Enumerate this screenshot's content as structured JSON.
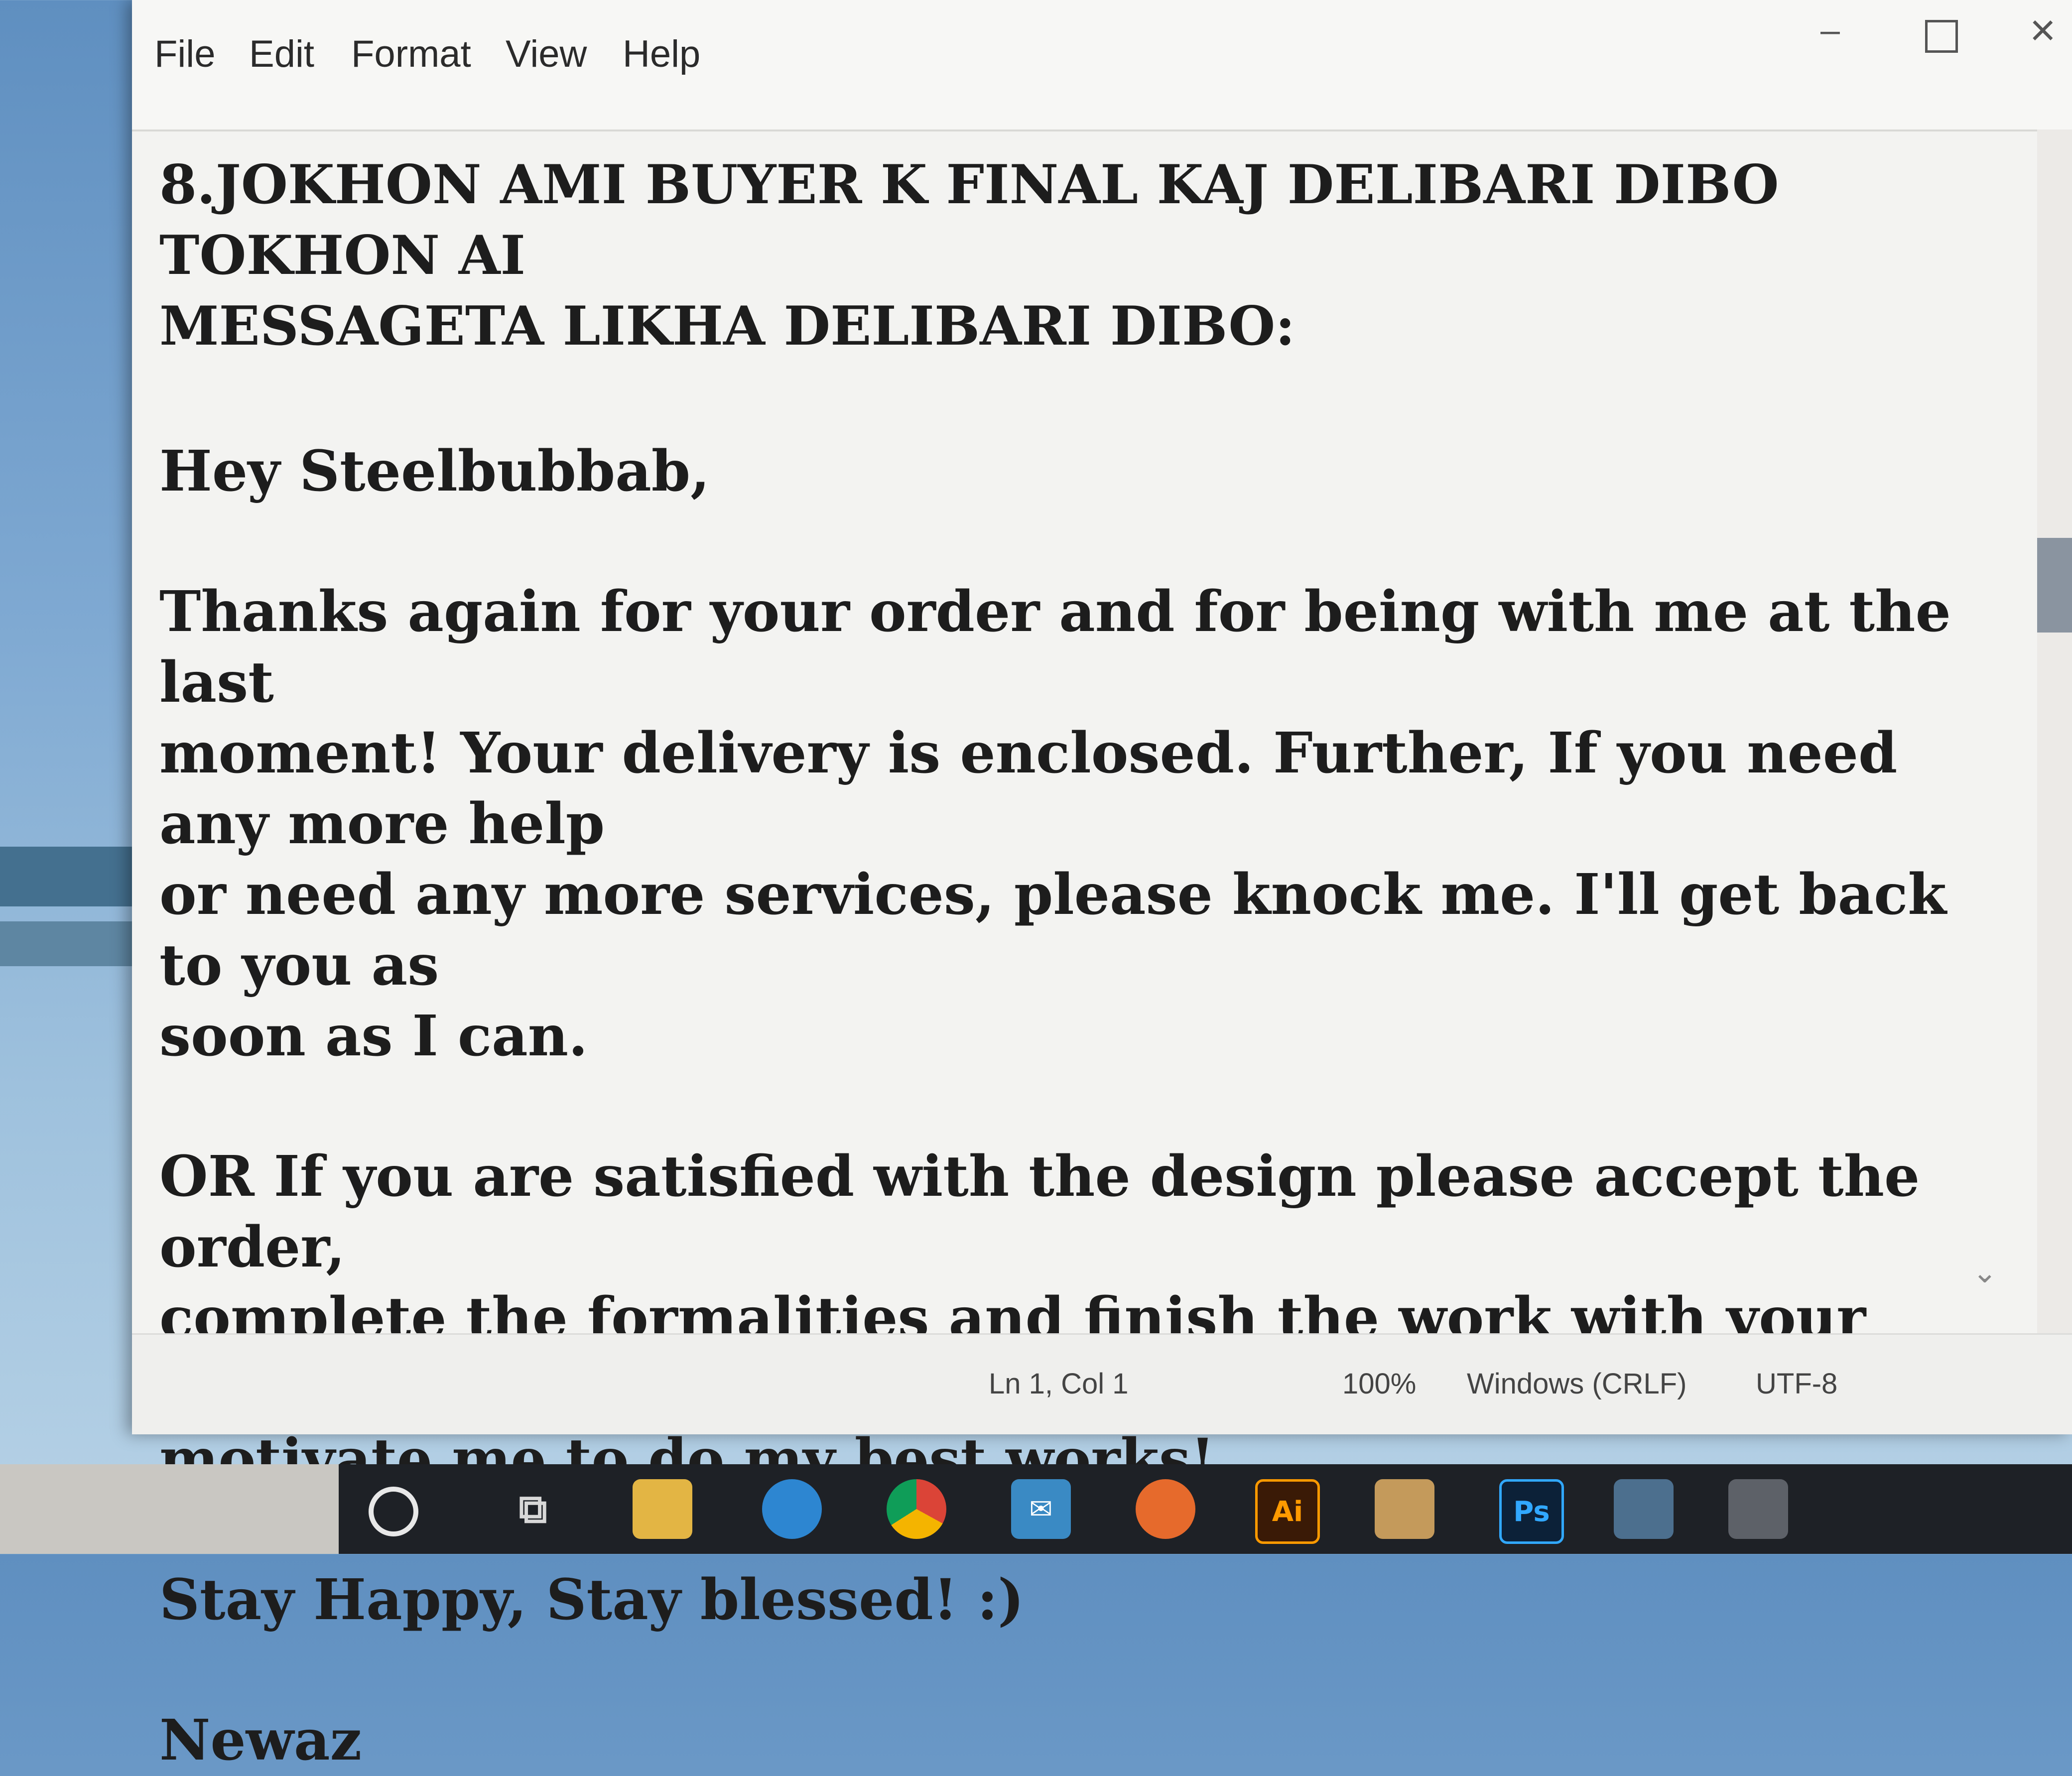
{
  "menubar": {
    "items": [
      "File",
      "Edit",
      "Format",
      "View",
      "Help"
    ],
    "minimize": "–",
    "close": "×"
  },
  "document": {
    "heading": "8.JOKHON AMI BUYER K FINAL KAJ DELIBARI DIBO TOKHON AI\nMESSAGETA LIKHA DELIBARI DIBO:",
    "greeting": "Hey Steelbubbab,",
    "body1": "Thanks again for your order and for being with me at the last\nmoment! Your delivery is enclosed. Further, If you need any more help\nor need any more services, please knock me. I'll get back to you as\nsoon as I can.",
    "body2": "OR If you are satisfied with the design please accept the order,\ncomplete the formalities and finish the work with your own style. It'll\nmotivate me to do my best works!",
    "closing": "Stay Happy, Stay blessed! :)",
    "signature": "Newaz"
  },
  "statusbar": {
    "position": "Ln 1, Col 1",
    "zoom": "100%",
    "line_endings": "Windows (CRLF)",
    "encoding": "UTF-8"
  },
  "taskbar": {
    "illustrator_label": "Ai",
    "photoshop_label": "Ps"
  },
  "icons": {
    "cortana": "search-circle-icon",
    "task_view": "task-view-icon",
    "explorer": "folder-icon",
    "edge": "edge-browser-icon",
    "chrome": "chrome-browser-icon",
    "mail": "mail-icon",
    "firefox": "firefox-browser-icon",
    "store": "store-icon"
  }
}
